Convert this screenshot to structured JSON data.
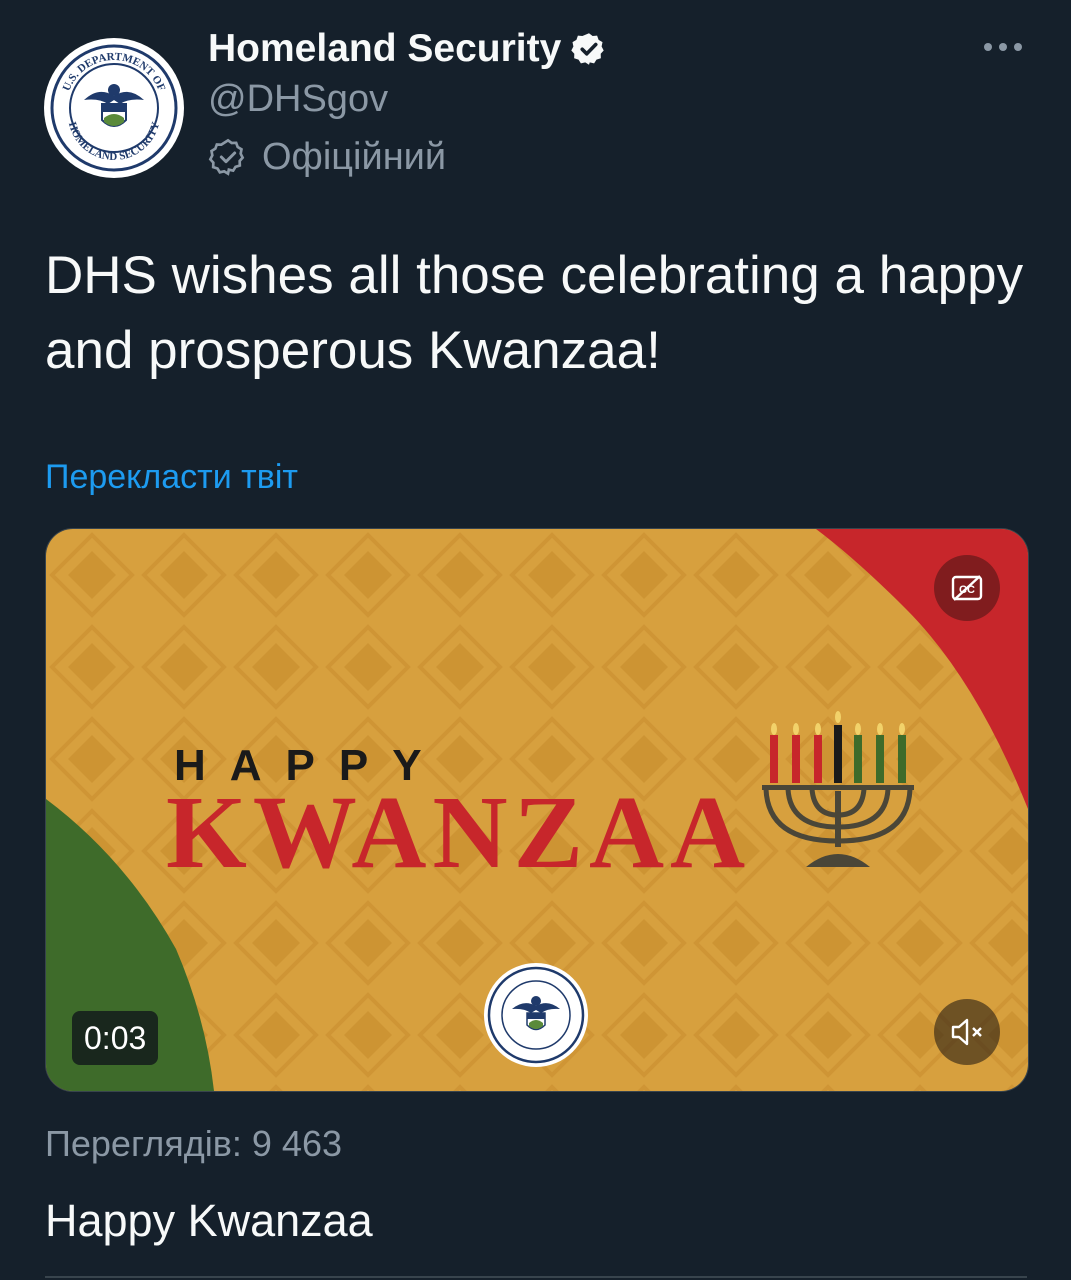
{
  "author": {
    "display_name": "Homeland Security",
    "handle": "@DHSgov",
    "official_label": "Офіційний",
    "avatar_text_top": "U.S. DEPARTMENT OF",
    "avatar_text_bottom": "HOMELAND SECURITY"
  },
  "tweet": {
    "text": "DHS wishes all those celebrating a happy and prosperous Kwanzaa!",
    "translate_link": "Перекласти твіт"
  },
  "media": {
    "happy": "HAPPY",
    "kwanzaa": "KWANZAA",
    "timer": "0:03",
    "cc_icon": "closed-captions-off-icon",
    "mute_icon": "muted-speaker-icon",
    "colors": {
      "gold": "#d7a03e",
      "red": "#c7262b",
      "green": "#3e6b2a"
    }
  },
  "stats": {
    "views": "Переглядів: 9 463"
  },
  "card_caption": "Happy Kwanzaa",
  "colors": {
    "background": "#15202b",
    "accent": "#1d9bf0",
    "muted": "#8b98a5"
  }
}
